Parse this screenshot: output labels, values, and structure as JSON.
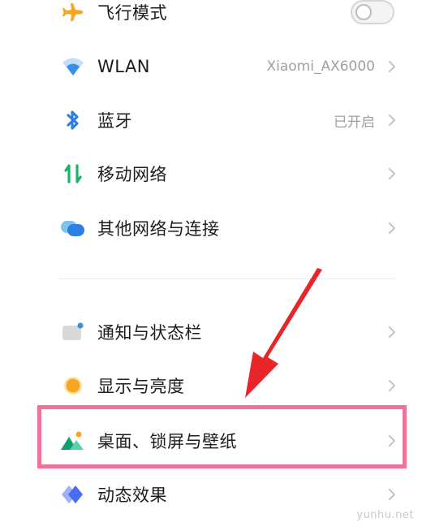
{
  "settings": {
    "airplane": {
      "label": "飞行模式",
      "icon": "airplane-icon",
      "toggle_on": false
    },
    "wlan": {
      "label": "WLAN",
      "value": "Xiaomi_AX6000",
      "icon": "wifi-icon"
    },
    "bluetooth": {
      "label": "蓝牙",
      "value": "已开启",
      "icon": "bluetooth-icon"
    },
    "mobile": {
      "label": "移动网络",
      "icon": "mobile-data-icon"
    },
    "other_network": {
      "label": "其他网络与连接",
      "icon": "connections-icon"
    },
    "notifications": {
      "label": "通知与状态栏",
      "icon": "notification-icon"
    },
    "display": {
      "label": "显示与亮度",
      "icon": "display-icon"
    },
    "wallpaper": {
      "label": "桌面、锁屏与壁纸",
      "icon": "wallpaper-icon"
    },
    "animation": {
      "label": "动态效果",
      "icon": "animation-icon"
    }
  },
  "watermark": "yunhu.net",
  "colors": {
    "airplane": "#f5a623",
    "wifi": "#3a8ee6",
    "bluetooth": "#2f7fe0",
    "mobile": "#19b36b",
    "highlight": "#ee7397",
    "arrow": "#e8262a"
  }
}
